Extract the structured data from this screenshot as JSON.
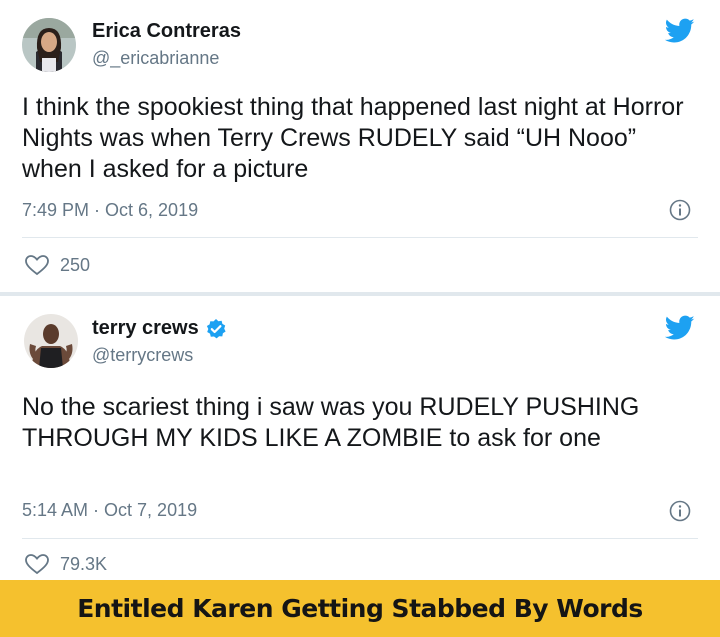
{
  "tweets": [
    {
      "author_name": "Erica Contreras",
      "handle": "@_ericabrianne",
      "verified": false,
      "text": "I think the spookiest thing that happened last night at Horror Nights was when Terry Crews RUDELY said “UH Nooo” when I asked for a picture",
      "timestamp": "7:49 PM · Oct 6, 2019",
      "likes": "250"
    },
    {
      "author_name": "terry crews",
      "handle": "@terrycrews",
      "verified": true,
      "text": "No the scariest thing i saw was you RUDELY PUSHING THROUGH MY KIDS LIKE A ZOMBIE to ask for one",
      "timestamp": "5:14 AM · Oct 7, 2019",
      "likes": "79.3K"
    }
  ],
  "caption": "Entitled Karen Getting Stabbed By Words",
  "colors": {
    "twitter_blue": "#1da1f2",
    "secondary_text": "#657786",
    "caption_bg": "#f5c12e"
  },
  "icons": [
    "twitter-bird-icon",
    "info-icon",
    "heart-icon",
    "verified-badge-icon"
  ]
}
